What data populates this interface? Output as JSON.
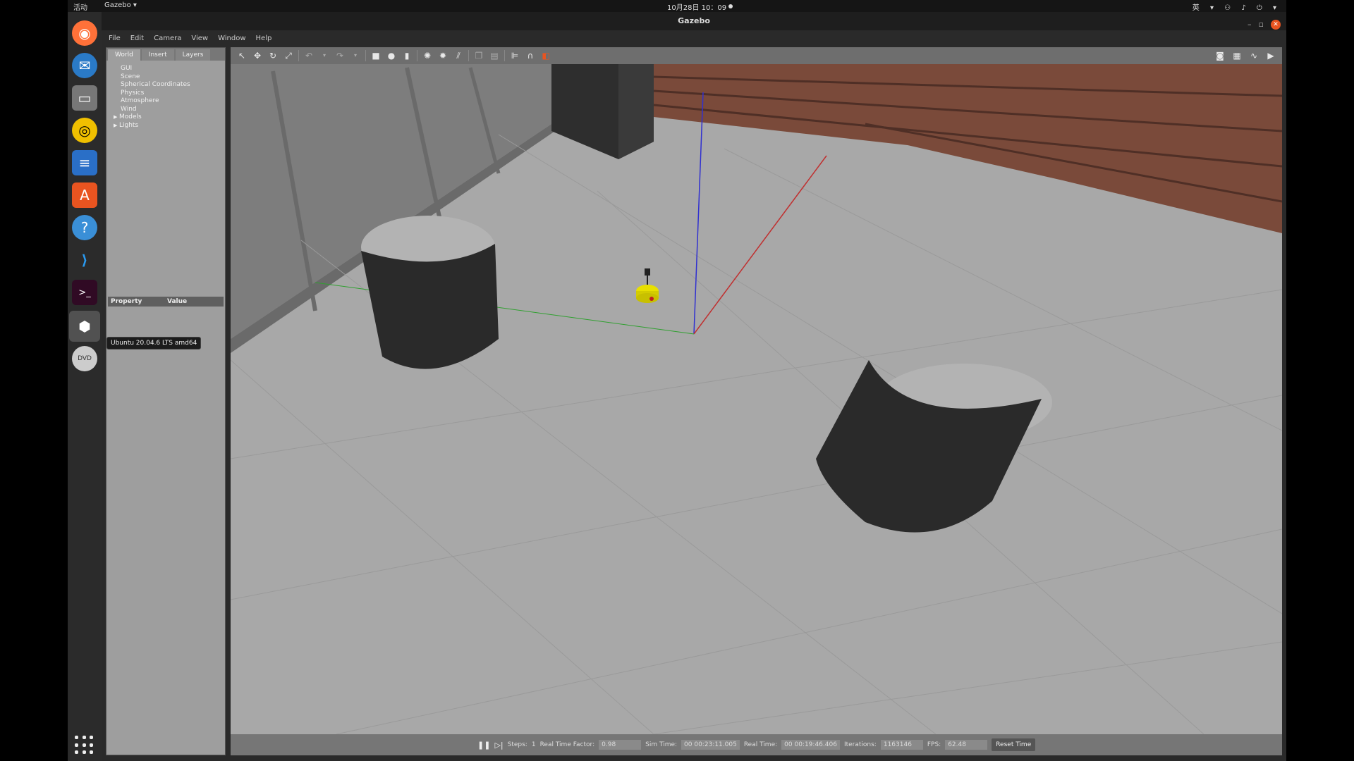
{
  "topbar": {
    "activities": "活动",
    "app_menu": "Gazebo ▾",
    "clock": "10月28日 10：09",
    "tray": "英 ▾  ⚇ ♪ ⏻ ▾"
  },
  "dock": {
    "items": [
      "firefox-icon",
      "thunderbird-icon",
      "files-icon",
      "rhythmbox-icon",
      "writer-icon",
      "software-icon",
      "help-icon",
      "vscode-icon",
      "terminal-icon",
      "gazebo-icon",
      "dvd-icon"
    ],
    "tooltip": "Ubuntu 20.04.6 LTS amd64"
  },
  "window": {
    "title": "Gazebo",
    "menu": [
      "File",
      "Edit",
      "Camera",
      "View",
      "Window",
      "Help"
    ]
  },
  "left_panel": {
    "tabs": [
      "World",
      "Insert",
      "Layers"
    ],
    "tree": {
      "items": [
        "GUI",
        "Scene",
        "Spherical Coordinates",
        "Physics",
        "Atmosphere",
        "Wind"
      ],
      "expandable": [
        "Models",
        "Lights"
      ]
    },
    "property_header": {
      "property": "Property",
      "value": "Value"
    }
  },
  "statusbar": {
    "steps_label": "Steps:",
    "steps_value": "1",
    "real_time_factor_label": "Real Time Factor:",
    "real_time_factor": "0.98",
    "sim_time_label": "Sim Time:",
    "sim_time": "00 00:23:11.005",
    "real_time_label": "Real Time:",
    "real_time": "00 00:19:46.406",
    "iterations_label": "Iterations:",
    "iterations": "1163146",
    "fps_label": "FPS:",
    "fps": "62.48",
    "reset_button": "Reset Time"
  },
  "colors": {
    "accent": "#e95420",
    "ground": "#a9a9a9",
    "robot": "#e8e000"
  }
}
